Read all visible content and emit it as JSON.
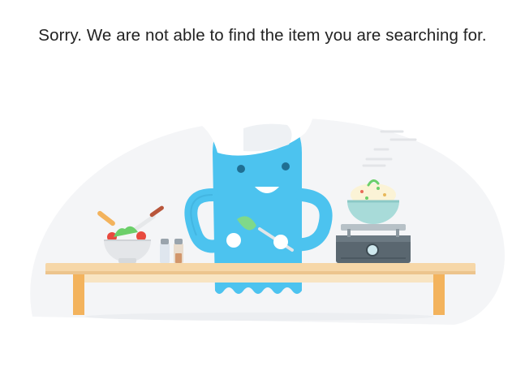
{
  "message": {
    "text": "Sorry. We are not able to find the item you are searching for."
  },
  "illustration": {
    "subject": "chef-ghost-cooking",
    "colors": {
      "background_blob": "#f4f5f7",
      "ghost": "#4cc3ef",
      "ghost_shadow": "#3aa9d6",
      "chef_hat": "#ffffff",
      "table_top": "#f6d7a8",
      "table_legs": "#f3b35d",
      "stove": "#5a6770",
      "bowl": "#a8dbd9",
      "salad": "#6ccf6a",
      "steam": "#e3e5e8"
    }
  }
}
